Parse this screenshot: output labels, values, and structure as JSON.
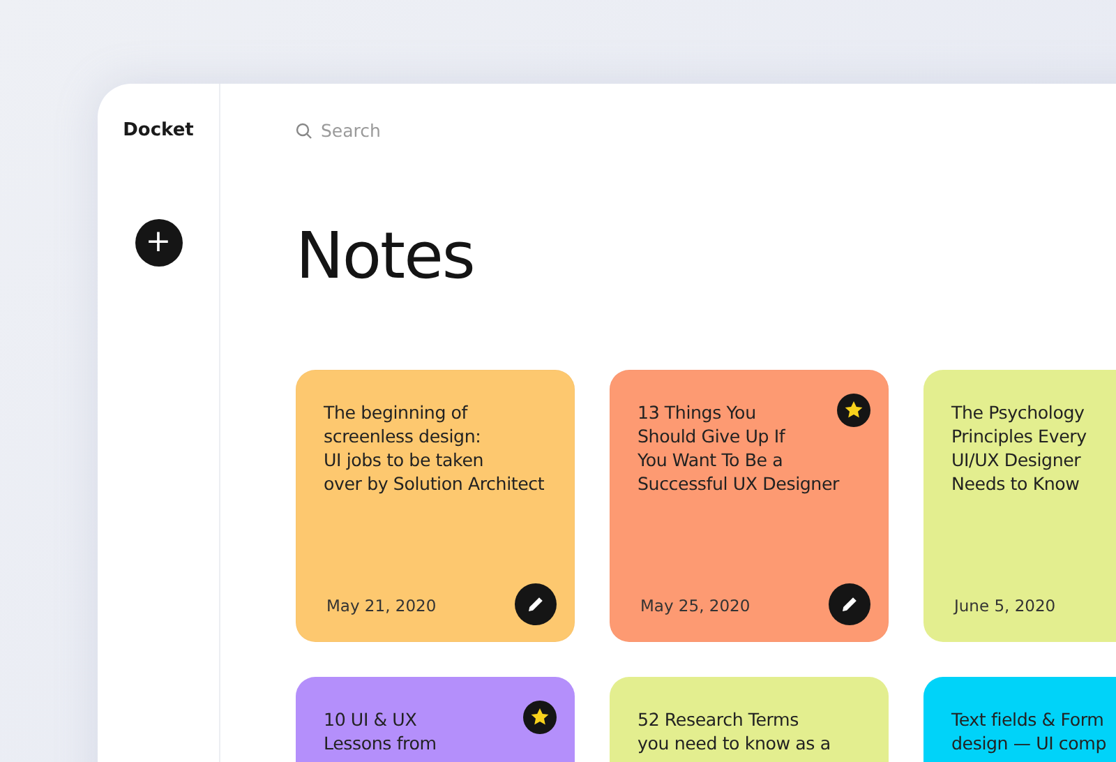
{
  "sidebar": {
    "brand": "Docket",
    "add_button": "+"
  },
  "search": {
    "placeholder": "Search"
  },
  "heading": "Notes",
  "notes": [
    {
      "title_lines": [
        "The beginning of",
        "screenless design:",
        "UI jobs to be taken",
        "over by Solution Architect"
      ],
      "date": "May 21, 2020",
      "color": "#fdc86f",
      "starred": false,
      "edit_button": true
    },
    {
      "title_lines": [
        "13 Things You",
        "Should Give Up If",
        "You Want To Be a",
        "Successful UX Designer"
      ],
      "date": "May 25, 2020",
      "color": "#fd9a72",
      "starred": true,
      "edit_button": true
    },
    {
      "title_lines": [
        "The Psychology",
        "Principles Every",
        "UI/UX Designer",
        "Needs to Know"
      ],
      "date": "June 5, 2020",
      "color": "#e3ee8f",
      "starred": false,
      "edit_button": false
    },
    {
      "title_lines": [
        "10 UI & UX",
        "Lessons from"
      ],
      "color": "#b48ffb",
      "starred": true,
      "edit_button": false
    },
    {
      "title_lines": [
        "52 Research Terms",
        "you need to know as a"
      ],
      "color": "#e3ee8f",
      "starred": false,
      "edit_button": false
    },
    {
      "title_lines": [
        "Text fields & Form",
        "design — UI comp"
      ],
      "color": "#00d3f9",
      "starred": false,
      "edit_button": false
    }
  ]
}
